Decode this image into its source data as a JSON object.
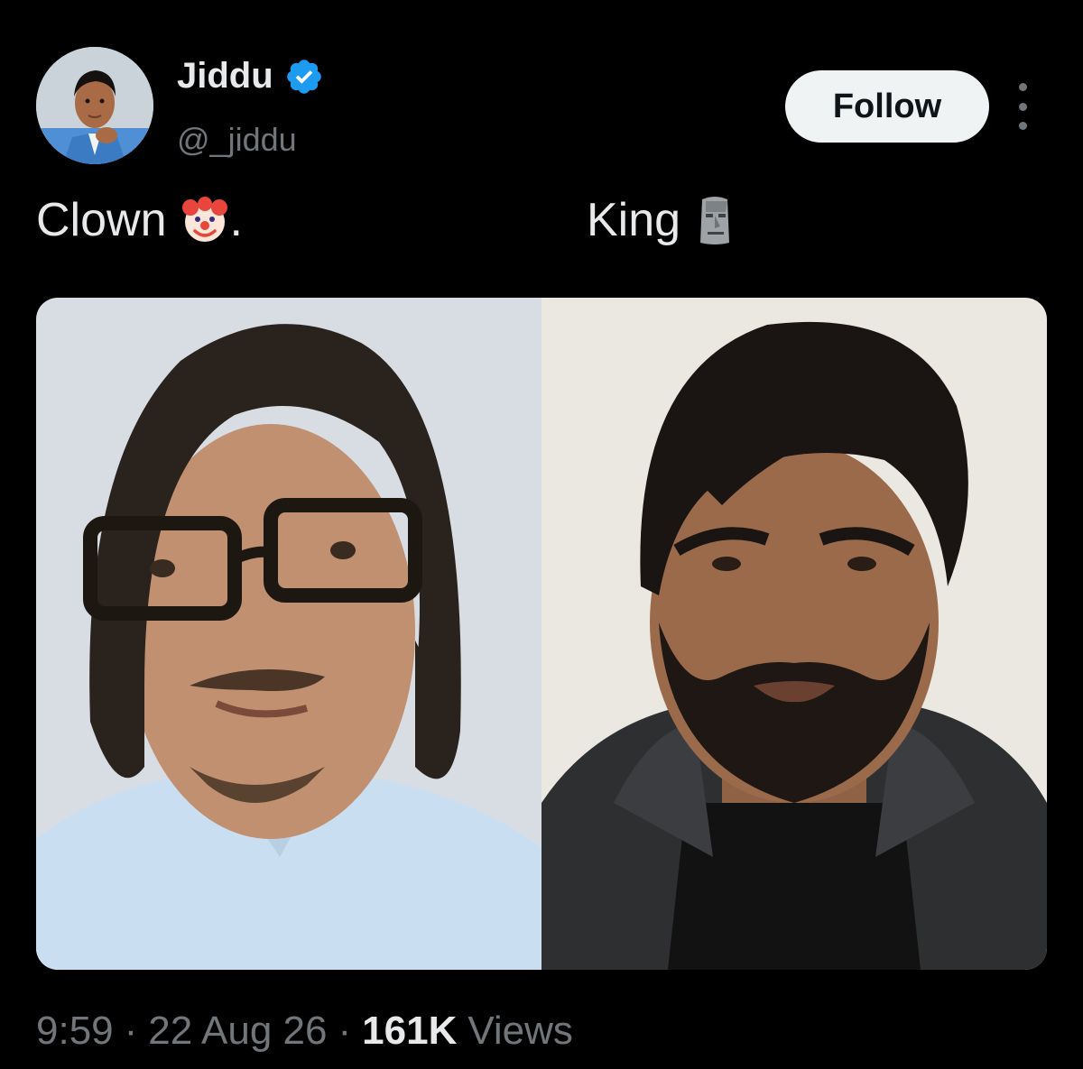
{
  "author": {
    "display_name": "Jiddu",
    "handle": "@_jiddu",
    "verified_icon": "verified-badge-icon",
    "avatar": "profile-avatar"
  },
  "actions": {
    "follow_label": "Follow",
    "more_icon": "more-vertical-icon"
  },
  "tweet": {
    "left_caption": "Clown",
    "left_emoji": "clown-face-emoji",
    "left_suffix": ".",
    "right_caption": "King",
    "right_emoji": "moai-emoji"
  },
  "media": {
    "left_photo": "photo-man-with-glasses",
    "right_photo": "photo-man-with-beard"
  },
  "meta": {
    "time": "9:59",
    "separator": "·",
    "date": "22 Aug 26",
    "views_count": "161K",
    "views_label": "Views"
  },
  "colors": {
    "background": "#000000",
    "primary_text": "#e7e9ea",
    "secondary_text": "#71767b",
    "verified_blue": "#1d9bf0",
    "follow_bg": "#eff3f4",
    "follow_text": "#0f1419"
  }
}
